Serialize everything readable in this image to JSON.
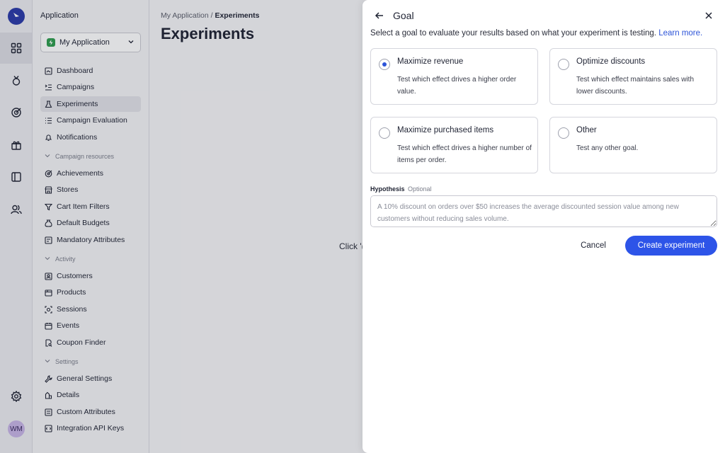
{
  "rail": {
    "avatar_initials": "WM",
    "active_index": 0,
    "icons": [
      "dashboard-grid-icon",
      "badge-icon",
      "target-icon",
      "gift-icon",
      "book-icon",
      "users-icon"
    ],
    "bottom_icons": [
      "settings-gear-icon"
    ]
  },
  "sidebar": {
    "app_title": "Application",
    "app_select": {
      "selected": "My Application"
    },
    "items": [
      {
        "label": "Dashboard",
        "icon": "dashboard-icon"
      },
      {
        "label": "Campaigns",
        "icon": "campaigns-icon"
      },
      {
        "label": "Experiments",
        "icon": "flask-icon",
        "active": true
      },
      {
        "label": "Campaign Evaluation",
        "icon": "list-icon"
      },
      {
        "label": "Notifications",
        "icon": "bell-icon"
      }
    ],
    "sections": [
      {
        "title": "Campaign resources",
        "items": [
          {
            "label": "Achievements",
            "icon": "achievement-icon"
          },
          {
            "label": "Stores",
            "icon": "store-icon"
          },
          {
            "label": "Cart Item Filters",
            "icon": "filter-icon"
          },
          {
            "label": "Default Budgets",
            "icon": "budget-icon"
          },
          {
            "label": "Mandatory Attributes",
            "icon": "attributes-icon"
          }
        ]
      },
      {
        "title": "Activity",
        "items": [
          {
            "label": "Customers",
            "icon": "customer-icon"
          },
          {
            "label": "Products",
            "icon": "product-icon"
          },
          {
            "label": "Sessions",
            "icon": "session-icon"
          },
          {
            "label": "Events",
            "icon": "calendar-icon"
          },
          {
            "label": "Coupon Finder",
            "icon": "coupon-icon"
          }
        ]
      },
      {
        "title": "Settings",
        "items": [
          {
            "label": "General Settings",
            "icon": "wrench-icon"
          },
          {
            "label": "Details",
            "icon": "details-icon"
          },
          {
            "label": "Custom Attributes",
            "icon": "custom-attributes-icon"
          },
          {
            "label": "Integration API Keys",
            "icon": "api-key-icon"
          }
        ]
      }
    ]
  },
  "main": {
    "breadcrumb": {
      "parent": "My Application",
      "separator": "/",
      "current": "Experiments"
    },
    "title": "Experiments",
    "empty_hint": "Click '("
  },
  "panel": {
    "title": "Goal",
    "description": "Select a goal to evaluate your results based on what your experiment is testing.",
    "learn_more": "Learn more.",
    "options": [
      {
        "title": "Maximize revenue",
        "description": "Test which effect drives a higher order value.",
        "selected": true
      },
      {
        "title": "Optimize discounts",
        "description": "Test which effect maintains sales with lower discounts.",
        "selected": false
      },
      {
        "title": "Maximize purchased items",
        "description": "Test which effect drives a higher number of items per order.",
        "selected": false
      },
      {
        "title": "Other",
        "description": "Test any other goal.",
        "selected": false
      }
    ],
    "hypothesis": {
      "label": "Hypothesis",
      "optional": "Optional",
      "placeholder": "A 10% discount on orders over $50 increases the average discounted session value among new customers without reducing sales volume.",
      "value": ""
    },
    "cancel_label": "Cancel",
    "create_label": "Create experiment"
  },
  "colors": {
    "accent": "#2d54e8",
    "link": "#2d54d8",
    "brand_logo": "#2b3aa8",
    "app_badge": "#2e9d4e"
  }
}
